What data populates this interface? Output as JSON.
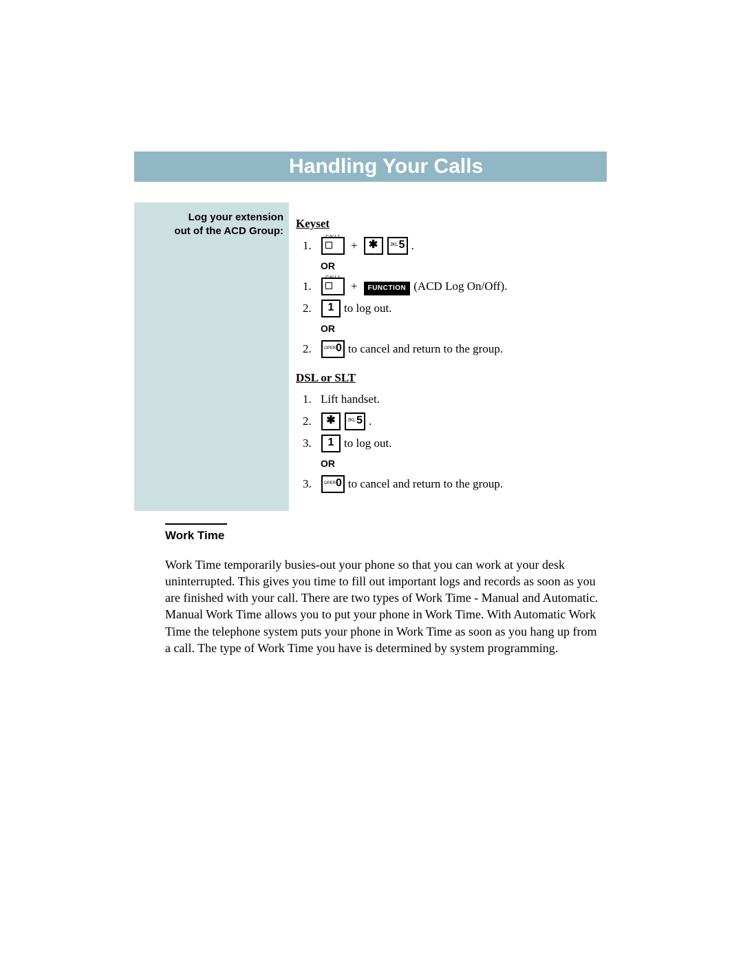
{
  "title": "Handling Your Calls",
  "sidebar": {
    "line1": "Log your extension",
    "line2": "out of the ACD Group:"
  },
  "keyset": {
    "heading": "Keyset",
    "step1a": {
      "num": "1.",
      "call1_label": "CALL1",
      "plus": "+",
      "star": "✱",
      "five_sub": "JKL",
      "five": "5",
      "period": "."
    },
    "or1": "OR",
    "step1b": {
      "num": "1.",
      "call1_label": "CALL1",
      "plus": "+",
      "func": "FUNCTION",
      "after": " (ACD Log On/Off)."
    },
    "step2a": {
      "num": "2.",
      "one": "1",
      "after": " to log out."
    },
    "or2": "OR",
    "step2b": {
      "num": "2.",
      "zero_sub": "OPER",
      "zero": "0",
      "after": " to cancel and return to the group."
    }
  },
  "dsl": {
    "heading": "DSL or SLT",
    "step1": {
      "num": "1.",
      "text": "Lift handset."
    },
    "step2": {
      "num": "2.",
      "star": "✱",
      "five_sub": "JKL",
      "five": "5",
      "period": "."
    },
    "step3a": {
      "num": "3.",
      "one": "1",
      "after": " to log out."
    },
    "or": "OR",
    "step3b": {
      "num": "3.",
      "zero_sub": "OPER",
      "zero": "0",
      "after": " to cancel and return to the group."
    }
  },
  "worktime": {
    "heading": "Work Time",
    "body": "Work Time temporarily busies-out your phone so that you can work at your desk uninterrupted.  This gives you time to fill out important logs and records as soon as you are finished with your call.  There are two types of Work Time - Manual and Automatic.  Manual Work Time allows you to put your phone in Work Time.  With Automatic Work Time the telephone system puts your phone in Work Time as soon as you hang up from a call.  The type of Work Time you have is determined by system programming."
  }
}
